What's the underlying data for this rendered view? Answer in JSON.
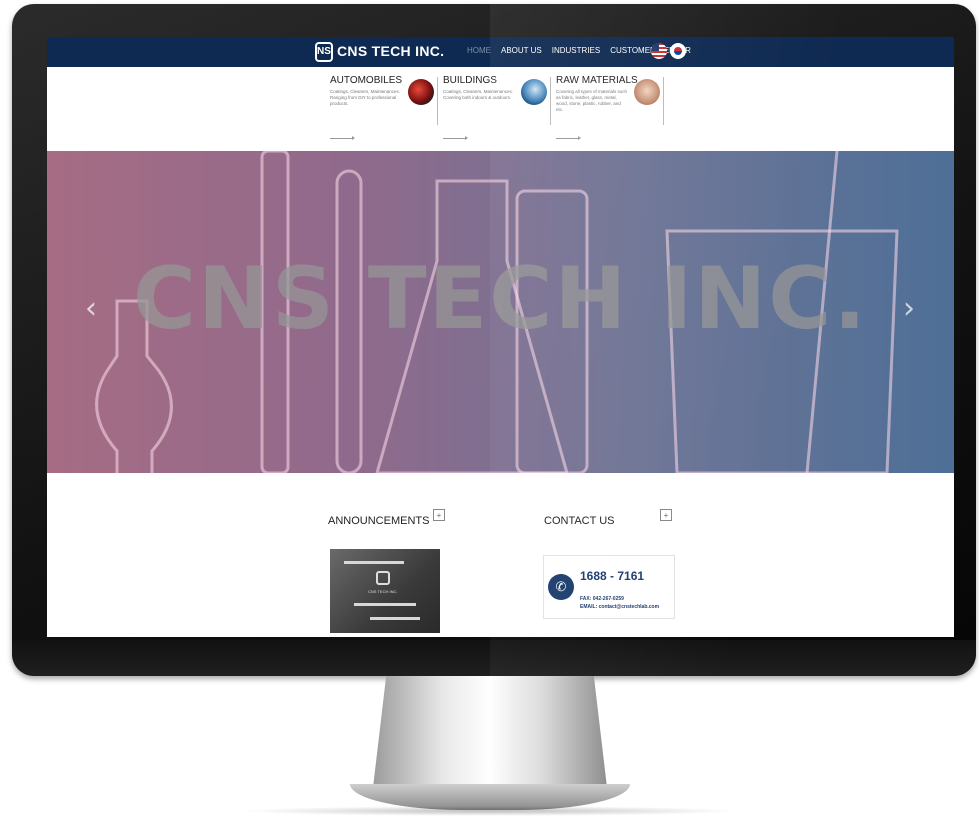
{
  "site": {
    "brand": "CNS TECH INC.",
    "logo_glyph": "NS"
  },
  "nav": {
    "items": [
      "HOME",
      "ABOUT US",
      "INDUSTRIES",
      "CUSTOMER CENTER"
    ],
    "active": "HOME"
  },
  "flags": [
    "us-flag-icon",
    "korea-flag-icon"
  ],
  "industries": [
    {
      "title": "AUTOMOBILES",
      "desc": "Coatings, Cleaners, Maintenances. Ranging from DIY to professional products."
    },
    {
      "title": "BUILDINGS",
      "desc": "Coatings, Cleaners, Maintenances. Covering both indoors & outdoors."
    },
    {
      "title": "RAW MATERIALS",
      "desc": "Covering all types of materials such as fabric, leather, glass, metal, wood, stone, plastic, rubber, and etc."
    }
  ],
  "hero": {
    "title": "CNS TECH INC.",
    "prev_arrow": "‹",
    "next_arrow": "›"
  },
  "announcements": {
    "title": "ANNOUNCEMENTS",
    "more": "+",
    "card_text": "CNS TECH INC."
  },
  "contact": {
    "title": "CONTACT US",
    "more": "+",
    "phone": "1688 - 7161",
    "fax": "FAX: 042-267-0259",
    "email": "EMAIL: contact@cnstechlab.com"
  },
  "colors": {
    "header_bg": "#0f2a52",
    "accent": "#1c3d6e"
  }
}
